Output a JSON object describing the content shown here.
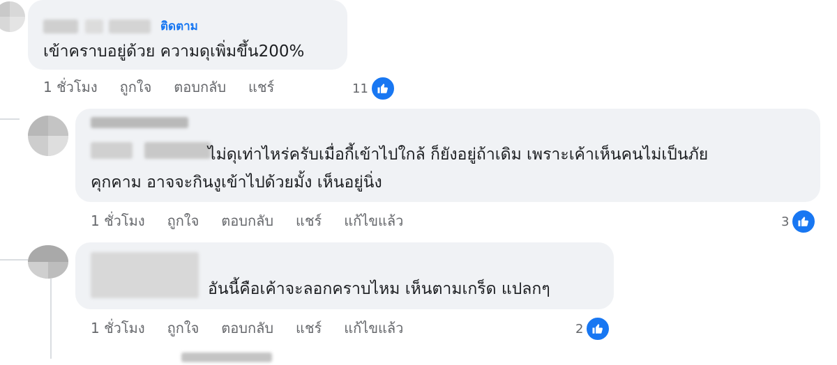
{
  "comments": [
    {
      "follow_label": "ติดตาม",
      "text": "เข้าคราบอยู่ด้วย ความดุเพิ่มขึ้น200%",
      "time": "1 ชั่วโมง",
      "like": "ถูกใจ",
      "reply": "ตอบกลับ",
      "share": "แชร์",
      "reaction_count": "11"
    },
    {
      "text_line1": "ไม่ดุเท่าไหร่ครับเมื่อกี้เข้าไปใกล้ ก็ยังอยู่ถ้าเดิม เพราะเค้าเห็นคนไม่เป็นภัย",
      "text_line2": "คุกคาม อาจจะกินงูเข้าไปด้วยมั้ง เห็นอยู่นิ่ง",
      "time": "1 ชั่วโมง",
      "like": "ถูกใจ",
      "reply": "ตอบกลับ",
      "share": "แชร์",
      "edited": "แก้ไขแล้ว",
      "reaction_count": "3"
    },
    {
      "text": "อันนี้คือเค้าจะลอกคราบไหม เห็นตามเกร็ด แปลกๆ",
      "time": "1 ชั่วโมง",
      "like": "ถูกใจ",
      "reply": "ตอบกลับ",
      "share": "แชร์",
      "edited": "แก้ไขแล้ว",
      "reaction_count": "2"
    }
  ],
  "colors": {
    "bubble": "#f0f2f5",
    "link": "#1877f2",
    "meta": "#65676b",
    "text": "#1c1e21"
  },
  "icons": [
    "thumbs-up-icon"
  ]
}
